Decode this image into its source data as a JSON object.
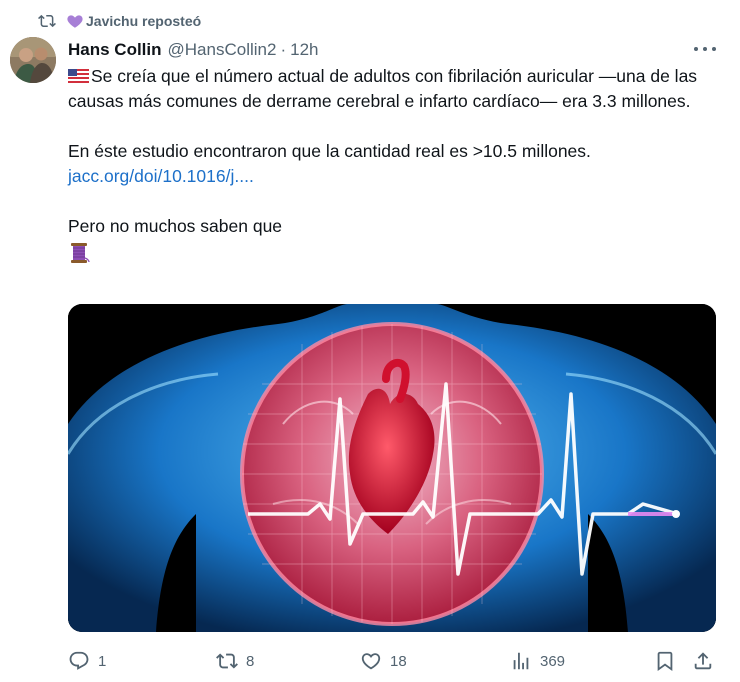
{
  "repost": {
    "label": "Javichu reposteó"
  },
  "author": {
    "name": "Hans Collin",
    "handle": "@HansCollin2",
    "separator": "·",
    "time": "12h"
  },
  "tweet": {
    "line1": "Se creía que el número actual de adultos con fibrilación auricular —una de las causas más comunes de derrame cerebral e infarto cardíaco— era 3.3 millones.",
    "line2": "En éste estudio encontraron que la cantidad real es >10.5 millones.",
    "link": "jacc.org/doi/10.1016/j....",
    "line3": "Pero no muchos saben que"
  },
  "actions": {
    "replies": "1",
    "reposts": "8",
    "likes": "18",
    "views": "369"
  },
  "colors": {
    "link": "#1d70c9",
    "muted": "#536471",
    "heart_purple": "#a77fd6",
    "repost_green": "#00ba7c"
  },
  "icons": [
    "repost-icon",
    "purple-heart-icon",
    "more-icon",
    "us-flag-icon",
    "thread-spool-icon",
    "reply-icon",
    "retweet-icon",
    "like-icon",
    "views-icon",
    "bookmark-icon",
    "share-icon"
  ]
}
